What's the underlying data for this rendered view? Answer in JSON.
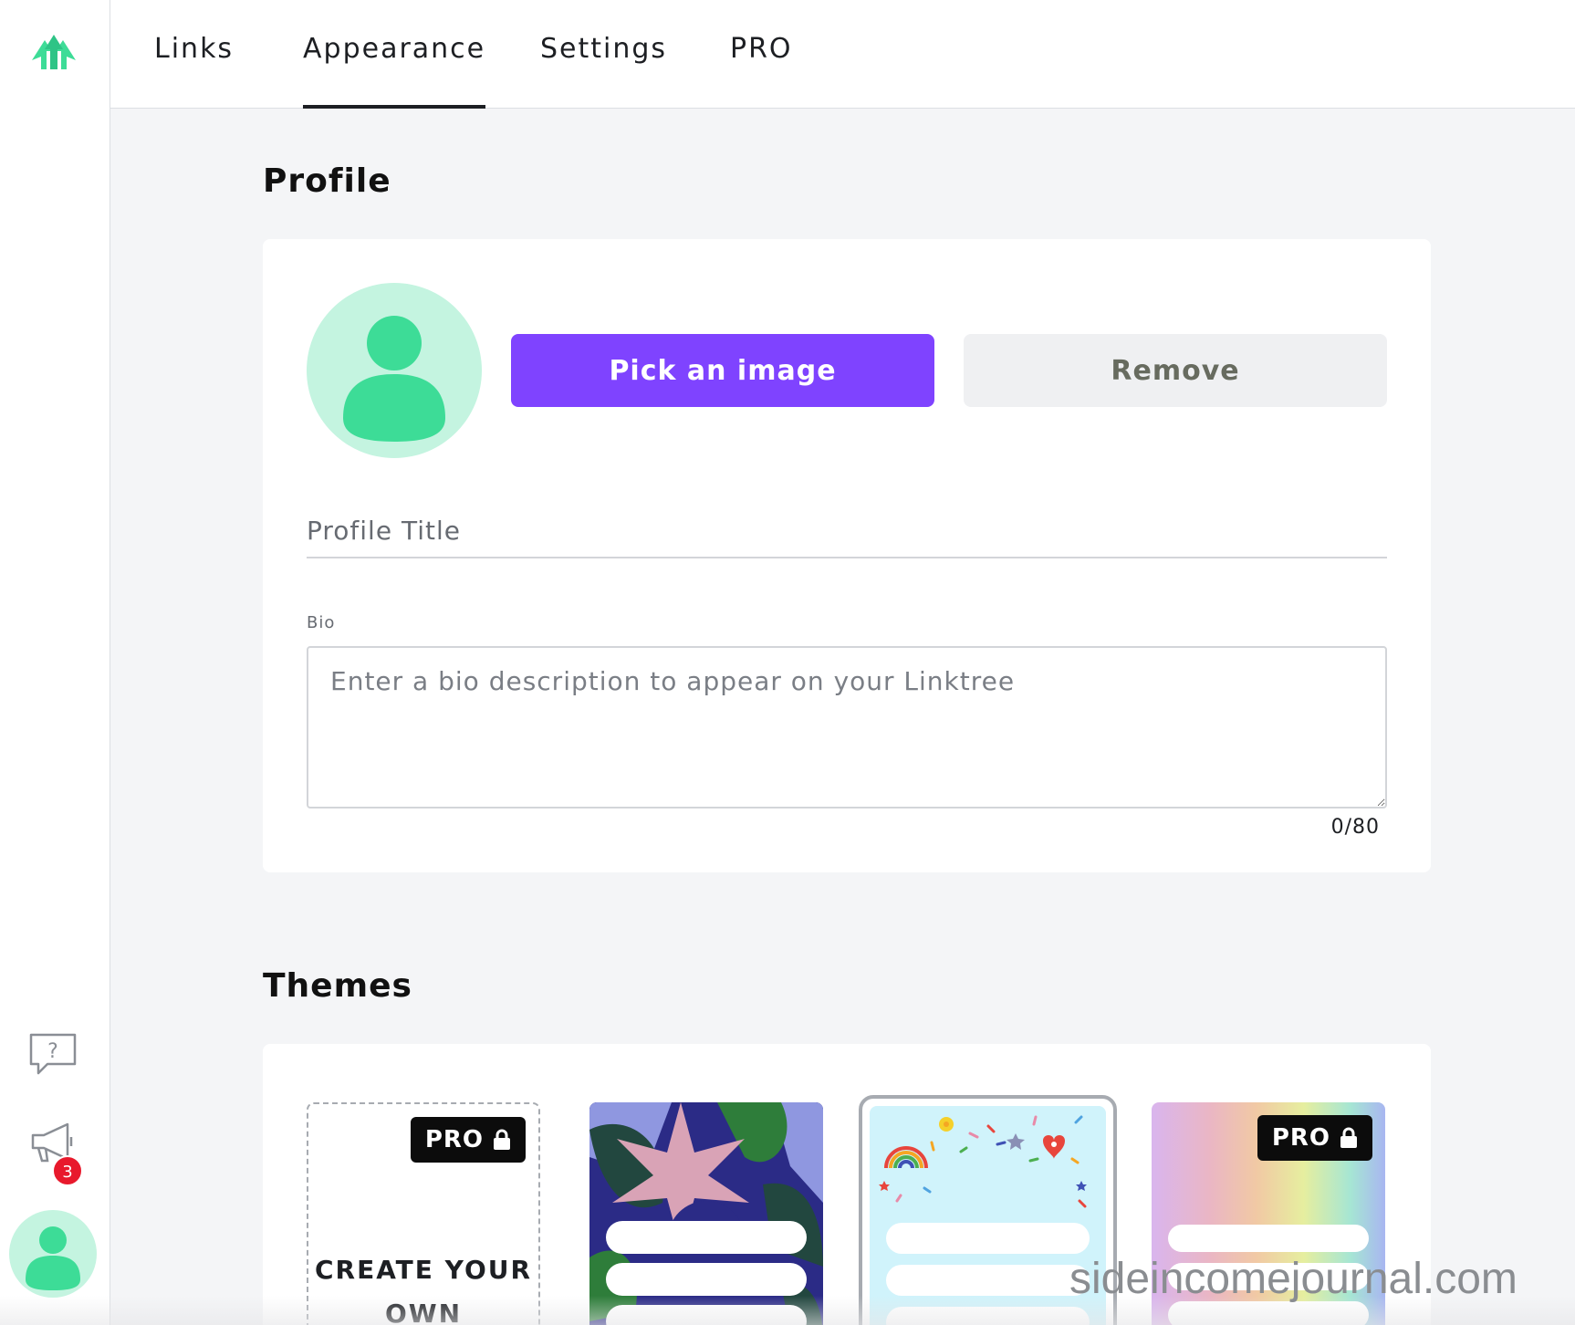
{
  "sidebar": {
    "logo_icon": "linktree-logo-icon",
    "help_icon": "help-chat-icon",
    "announcement_icon": "megaphone-icon",
    "notification_count": "3",
    "account_icon": "user-avatar-icon"
  },
  "nav": {
    "tabs": [
      {
        "label": "Links",
        "active": false
      },
      {
        "label": "Appearance",
        "active": true
      },
      {
        "label": "Settings",
        "active": false
      },
      {
        "label": "PRO",
        "active": false
      }
    ]
  },
  "profile": {
    "heading": "Profile",
    "pick_image_label": "Pick an image",
    "remove_label": "Remove",
    "title_placeholder": "Profile Title",
    "title_value": "",
    "bio_label": "Bio",
    "bio_placeholder": "Enter a bio description to appear on your Linktree",
    "bio_value": "",
    "bio_counter": "0/80"
  },
  "themes": {
    "heading": "Themes",
    "items": [
      {
        "name": "create-your-own",
        "label_line1": "CREATE YOUR",
        "label_line2": "OWN",
        "pro": true,
        "pro_label": "PRO"
      },
      {
        "name": "jungle",
        "pro": false
      },
      {
        "name": "confetti",
        "pro": false,
        "selected": true
      },
      {
        "name": "rainbow",
        "pro": true,
        "pro_label": "PRO"
      }
    ]
  },
  "watermark": "sideincomejournal.com",
  "colors": {
    "accent": "#7f43ff",
    "brand_green": "#3ddc97",
    "avatar_bg": "#c4f4e0",
    "badge_red": "#e8192c"
  }
}
